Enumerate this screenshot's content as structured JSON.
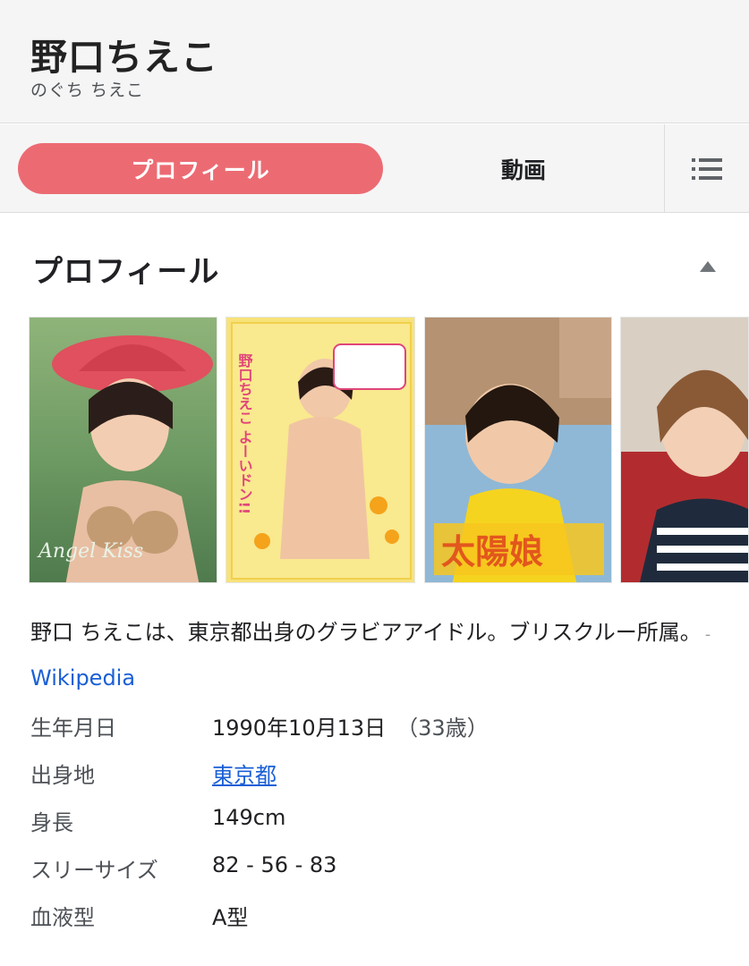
{
  "header": {
    "title": "野口ちえこ",
    "reading": "のぐち ちえこ"
  },
  "tabs": [
    {
      "label": "プロフィール",
      "active": true
    },
    {
      "label": "動画",
      "active": false
    }
  ],
  "menu_icon": "list-icon",
  "section": {
    "title": "プロフィール",
    "collapse_icon": "triangle-up-icon"
  },
  "gallery": {
    "thumbnails": [
      {
        "icon": "dvd-cover-image",
        "caption": "Angel Kiss"
      },
      {
        "icon": "dvd-cover-image",
        "caption": "野口ちえこ よーいドン!!"
      },
      {
        "icon": "dvd-cover-image",
        "caption": "太陽娘"
      },
      {
        "icon": "photo-image",
        "caption": ""
      }
    ]
  },
  "description": {
    "text": "野口 ちえこは、東京都出身のグラビアアイドル。ブリスクルー所属。",
    "separator": "-",
    "source": "Wikipedia"
  },
  "facts": [
    {
      "label": "生年月日",
      "value": "1990年10月13日",
      "extra": "（33歳）",
      "link": false
    },
    {
      "label": "出身地",
      "value": "東京都",
      "extra": "",
      "link": true
    },
    {
      "label": "身長",
      "value": "149cm",
      "extra": "",
      "link": false
    },
    {
      "label": "スリーサイズ",
      "value": "82 - 56 - 83",
      "extra": "",
      "link": false
    },
    {
      "label": "血液型",
      "value": "A型",
      "extra": "",
      "link": false
    }
  ],
  "colors": {
    "accent_tab": "#ec6b73",
    "link": "#1a5fd6",
    "header_bg": "#f5f5f5"
  }
}
